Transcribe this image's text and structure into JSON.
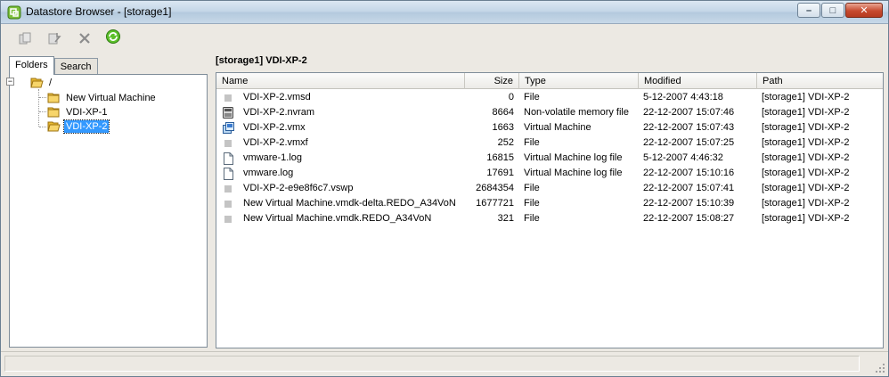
{
  "window": {
    "title": "Datastore Browser - [storage1]"
  },
  "title_buttons": {
    "minimize": "–",
    "maximize": "□",
    "close": "✕"
  },
  "toolbar": {
    "items": [
      {
        "icon": "copy-icon",
        "enabled": false
      },
      {
        "icon": "upload-icon",
        "enabled": false
      },
      {
        "icon": "delete-icon",
        "enabled": false
      },
      {
        "icon": "refresh-icon",
        "enabled": true
      }
    ]
  },
  "left_pane": {
    "tabs": [
      {
        "label": "Folders",
        "active": true
      },
      {
        "label": "Search",
        "active": false
      }
    ],
    "tree": {
      "root": {
        "label": "/",
        "expander": "−"
      },
      "children": [
        {
          "label": "New Virtual Machine",
          "selected": false
        },
        {
          "label": "VDI-XP-1",
          "selected": false
        },
        {
          "label": "VDI-XP-2",
          "selected": true
        }
      ]
    }
  },
  "right_pane": {
    "title": "[storage1] VDI-XP-2",
    "columns": [
      "Name",
      "Size",
      "Type",
      "Modified",
      "Path"
    ],
    "rows": [
      {
        "icon": "generic-file-icon",
        "name": "VDI-XP-2.vmsd",
        "size": "0",
        "type": "File",
        "modified": "5-12-2007 4:43:18",
        "path": "[storage1] VDI-XP-2"
      },
      {
        "icon": "nvram-icon",
        "name": "VDI-XP-2.nvram",
        "size": "8664",
        "type": "Non-volatile memory file",
        "modified": "22-12-2007 15:07:46",
        "path": "[storage1] VDI-XP-2"
      },
      {
        "icon": "virtual-machine-icon",
        "name": "VDI-XP-2.vmx",
        "size": "1663",
        "type": "Virtual Machine",
        "modified": "22-12-2007 15:07:43",
        "path": "[storage1] VDI-XP-2"
      },
      {
        "icon": "generic-file-icon",
        "name": "VDI-XP-2.vmxf",
        "size": "252",
        "type": "File",
        "modified": "22-12-2007 15:07:25",
        "path": "[storage1] VDI-XP-2"
      },
      {
        "icon": "log-file-icon",
        "name": "vmware-1.log",
        "size": "16815",
        "type": "Virtual Machine log file",
        "modified": "5-12-2007 4:46:32",
        "path": "[storage1] VDI-XP-2"
      },
      {
        "icon": "log-file-icon",
        "name": "vmware.log",
        "size": "17691",
        "type": "Virtual Machine log file",
        "modified": "22-12-2007 15:10:16",
        "path": "[storage1] VDI-XP-2"
      },
      {
        "icon": "generic-file-icon",
        "name": "VDI-XP-2-e9e8f6c7.vswp",
        "size": "2684354",
        "type": "File",
        "modified": "22-12-2007 15:07:41",
        "path": "[storage1] VDI-XP-2"
      },
      {
        "icon": "generic-file-icon",
        "name": "New Virtual Machine.vmdk-delta.REDO_A34VoN",
        "size": "1677721",
        "type": "File",
        "modified": "22-12-2007 15:10:39",
        "path": "[storage1] VDI-XP-2"
      },
      {
        "icon": "generic-file-icon",
        "name": "New Virtual Machine.vmdk.REDO_A34VoN",
        "size": "321",
        "type": "File",
        "modified": "22-12-2007 15:08:27",
        "path": "[storage1] VDI-XP-2"
      }
    ]
  },
  "status": {
    "text": ""
  }
}
